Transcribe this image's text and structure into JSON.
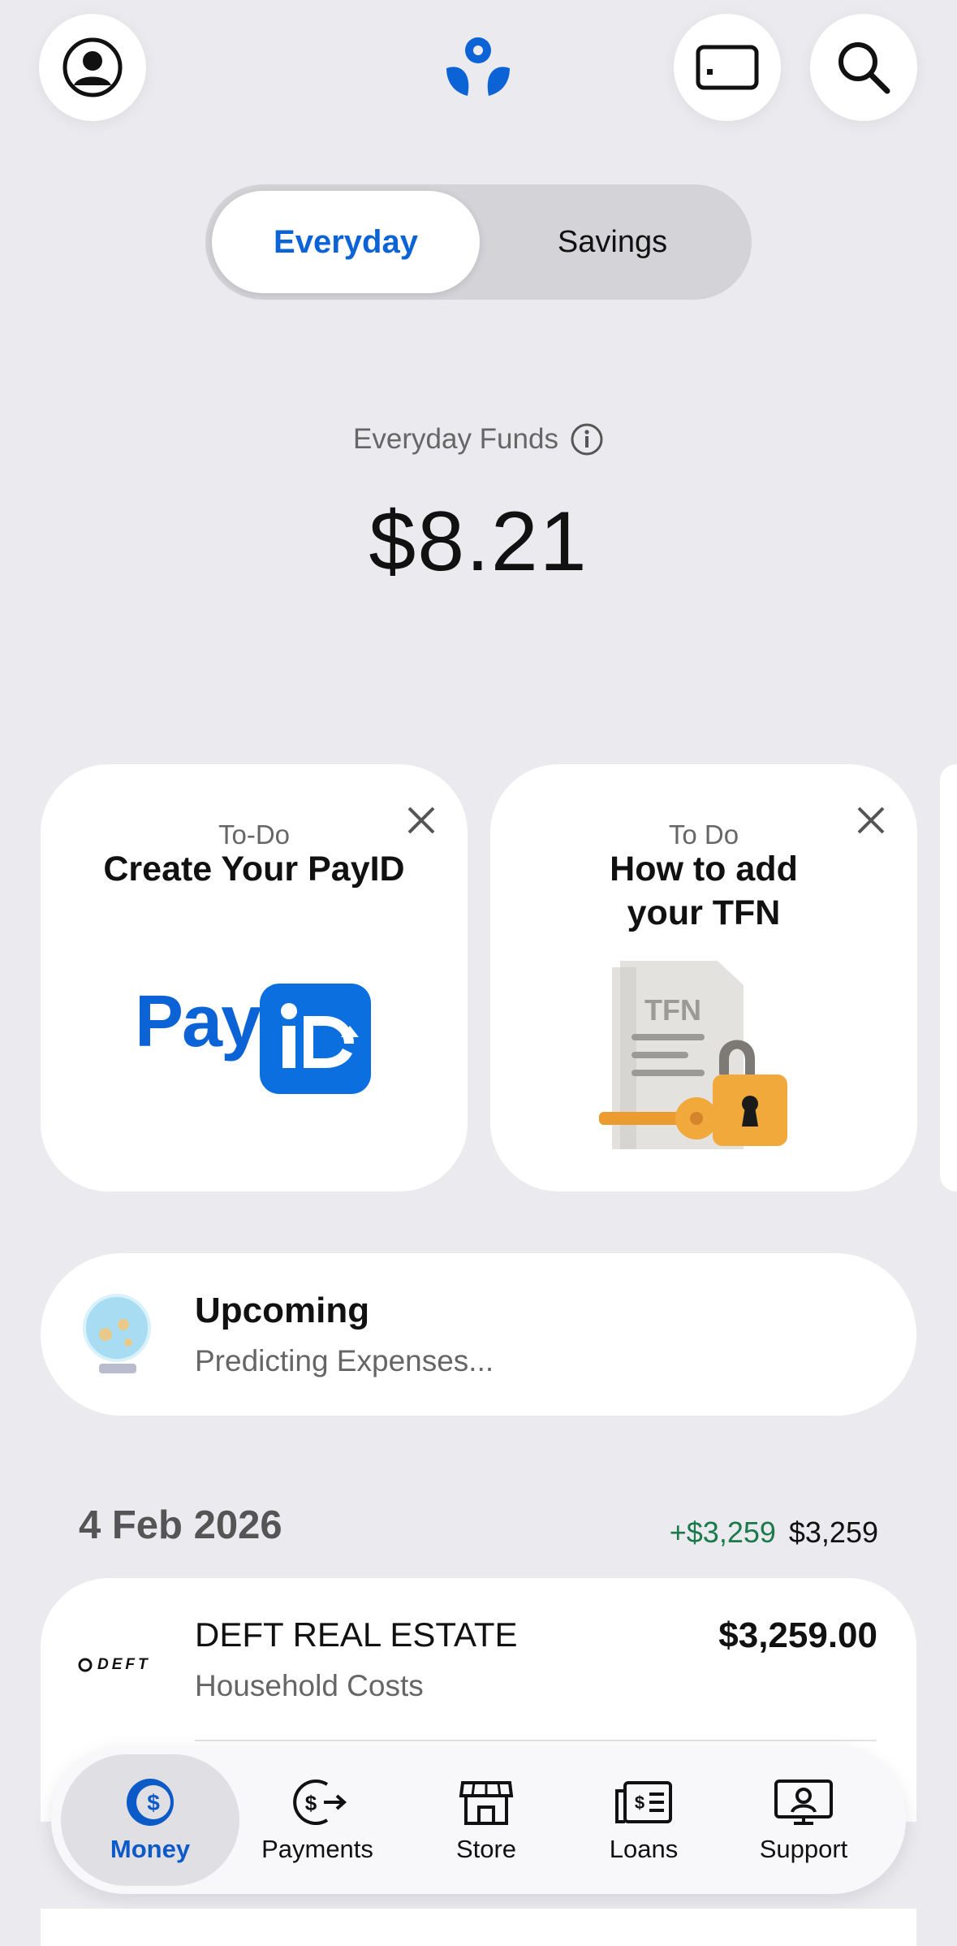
{
  "header": {
    "profile_icon": "person-circle-icon",
    "logo_icon": "bank-logo-icon",
    "card_icon": "card-icon",
    "search_icon": "search-icon"
  },
  "segment": {
    "active": "Everyday",
    "inactive": "Savings"
  },
  "funds": {
    "label": "Everyday Funds",
    "amount": "$8.21"
  },
  "cards": [
    {
      "kicker": "To-Do",
      "title": "Create Your PayID",
      "logo_text": "Pay"
    },
    {
      "kicker": "To Do",
      "title_line1": "How to add",
      "title_line2": "your TFN",
      "doc_text": "TFN"
    }
  ],
  "upcoming": {
    "title": "Upcoming",
    "subtitle": "Predicting Expenses..."
  },
  "date_group": {
    "date": "4 Feb 2026",
    "incoming": "+$3,259",
    "total": "$3,259"
  },
  "transactions": [
    {
      "merchant": "DEFT REAL ESTATE",
      "category": "Household Costs",
      "amount": "$3,259.00",
      "logo_text": "DEFT"
    }
  ],
  "tabs": [
    {
      "label": "Money",
      "icon": "dollar-circle-icon"
    },
    {
      "label": "Payments",
      "icon": "payments-icon"
    },
    {
      "label": "Store",
      "icon": "store-icon"
    },
    {
      "label": "Loans",
      "icon": "loans-icon"
    },
    {
      "label": "Support",
      "icon": "support-icon"
    }
  ],
  "colors": {
    "accent": "#0b63d6",
    "positive": "#1a7a4c",
    "background": "#ebeaef"
  }
}
